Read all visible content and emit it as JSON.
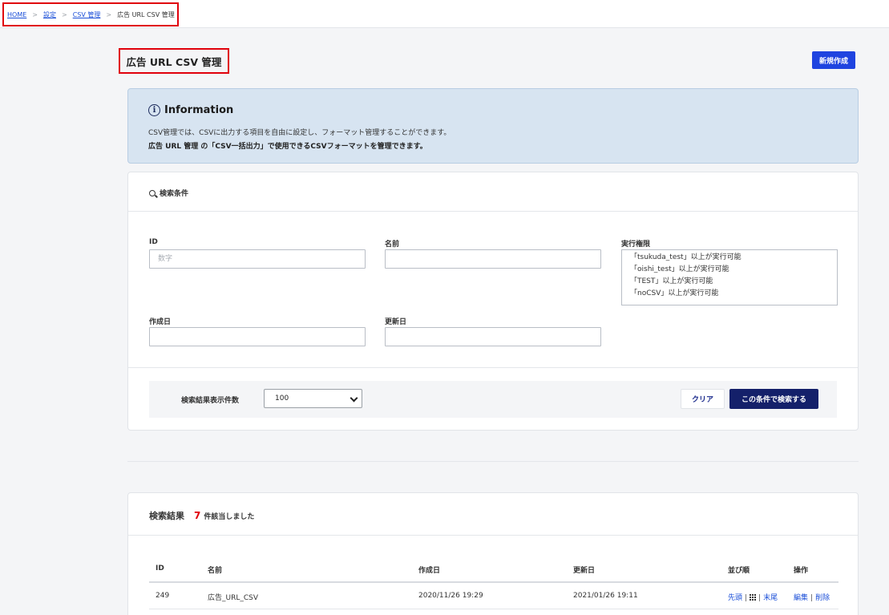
{
  "breadcrumb": {
    "home": "HOME",
    "settings": "設定",
    "csv_manage": "CSV 管理",
    "current": "広告 URL CSV 管理",
    "separator": ">"
  },
  "header": {
    "title": "広告 URL CSV 管理",
    "new_button": "新規作成"
  },
  "info": {
    "icon": "i",
    "title": "Information",
    "line1": "CSV管理では、CSVに出力する項目を自由に設定し、フォーマット管理することができます。",
    "line2": "広告 URL 管理 の「CSV一括出力」で使用できるCSVフォーマットを管理できます。"
  },
  "search": {
    "title": "検索条件",
    "id_label": "ID",
    "id_placeholder": "数字",
    "name_label": "名前",
    "permission_label": "実行権限",
    "permissions": [
      "「tsukuda_test」以上が実行可能",
      "「oishi_test」以上が実行可能",
      "「TEST」以上が実行可能",
      "「noCSV」以上が実行可能"
    ],
    "created_label": "作成日",
    "updated_label": "更新日",
    "count_label": "検索結果表示件数",
    "count_value": "100",
    "clear_button": "クリア",
    "search_button": "この条件で検索する"
  },
  "results": {
    "title": "検索結果",
    "count": "7",
    "suffix": "件該当しました",
    "columns": {
      "id": "ID",
      "name": "名前",
      "created": "作成日",
      "updated": "更新日",
      "order": "並び順",
      "actions": "操作"
    },
    "rows": [
      {
        "id": "249",
        "name": "広告_URL_CSV",
        "created": "2020/11/26 19:29",
        "updated": "2021/01/26 19:11",
        "order_first": "先頭",
        "order_last": "末尾",
        "edit": "編集",
        "delete": "削除"
      }
    ]
  },
  "colors": {
    "accent": "#1f44e0",
    "primary_dark": "#14206a",
    "highlight_border": "#e0000b",
    "info_bg": "#d7e4f1",
    "link": "#1b4fd8"
  }
}
